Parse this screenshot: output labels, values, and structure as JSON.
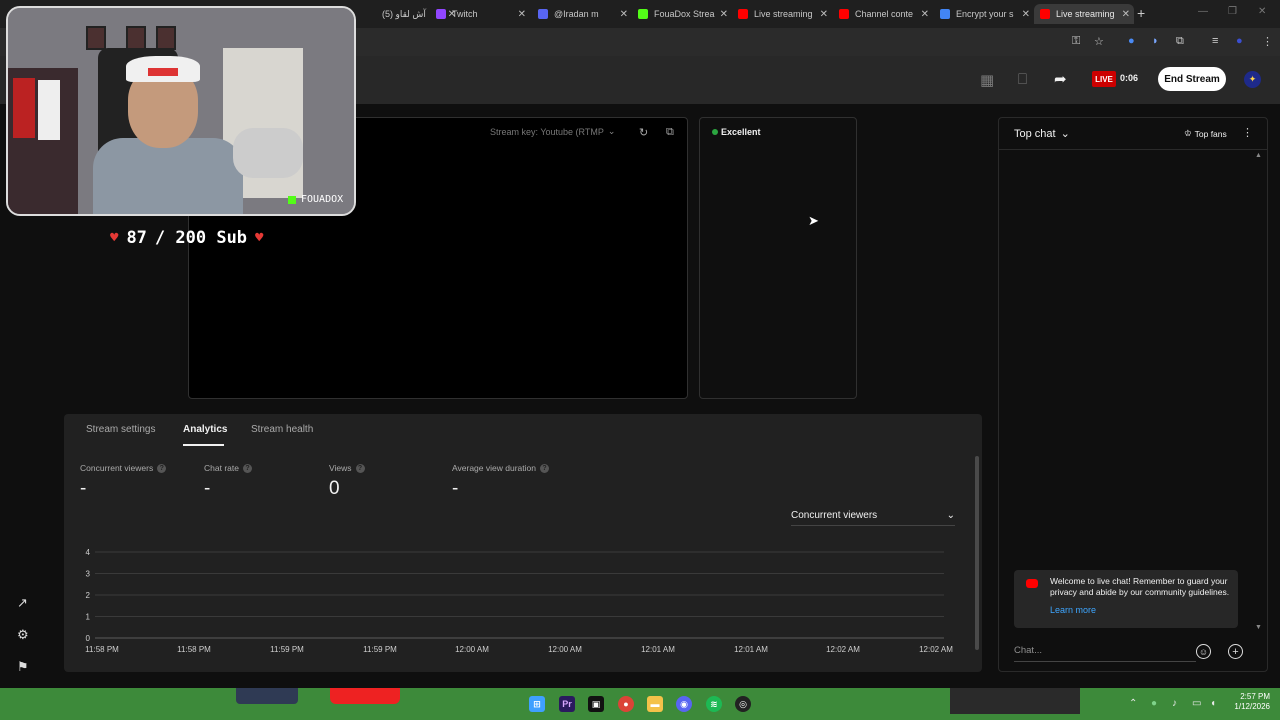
{
  "browser": {
    "tabs": [
      {
        "label": "(5) آش لقاو",
        "favicon": "none",
        "color": "#888888"
      },
      {
        "label": "Twitch",
        "favicon": "twitch",
        "color": "#9146ff"
      },
      {
        "label": "@Iradan m",
        "favicon": "discord",
        "color": "#5865f2"
      },
      {
        "label": "FouaDox Strea",
        "favicon": "kick",
        "color": "#53fc18"
      },
      {
        "label": "Live streaming",
        "favicon": "youtube",
        "color": "#ff0000"
      },
      {
        "label": "Channel conte",
        "favicon": "youtube",
        "color": "#ff0000"
      },
      {
        "label": "Encrypt your s",
        "favicon": "google",
        "color": "#4285f4"
      },
      {
        "label": "Live streaming",
        "favicon": "youtube",
        "color": "#ff0000",
        "active": true
      }
    ]
  },
  "header": {
    "live_label": "LIVE",
    "timer": "0:06",
    "end_stream_label": "End Stream"
  },
  "stream": {
    "stream_key_label": "Stream key: Youtube (RTMP",
    "health_label": "Excellent",
    "health_color": "#2ba640"
  },
  "webcam": {
    "channel_name": "FOUADOX",
    "sub_goal_current": "87",
    "sub_goal_text": "/ 200 Sub"
  },
  "analytics": {
    "tabs": [
      "Stream settings",
      "Analytics",
      "Stream health"
    ],
    "active_tab": "Analytics",
    "metrics": [
      {
        "label": "Concurrent viewers",
        "value": "-"
      },
      {
        "label": "Chat rate",
        "value": "-"
      },
      {
        "label": "Views",
        "value": "0"
      },
      {
        "label": "Average view duration",
        "value": "-"
      }
    ],
    "dropdown_value": "Concurrent viewers"
  },
  "chart_data": {
    "type": "line",
    "x": [
      "11:58 PM",
      "11:58 PM",
      "11:59 PM",
      "11:59 PM",
      "12:00 AM",
      "12:00 AM",
      "12:01 AM",
      "12:01 AM",
      "12:02 AM",
      "12:02 AM"
    ],
    "y_ticks": [
      0,
      1,
      2,
      3,
      4
    ],
    "ylim": [
      0,
      4
    ],
    "series": [
      {
        "values": []
      }
    ],
    "grid": true
  },
  "chat": {
    "title": "Top chat",
    "top_fans_label": "Top fans",
    "notice_text": "Welcome to live chat! Remember to guard your privacy and abide by our community guidelines.",
    "learn_more": "Learn more",
    "input_placeholder": "Chat..."
  },
  "taskbar": {
    "time": "2:57 PM",
    "date": "1/12/2026"
  }
}
